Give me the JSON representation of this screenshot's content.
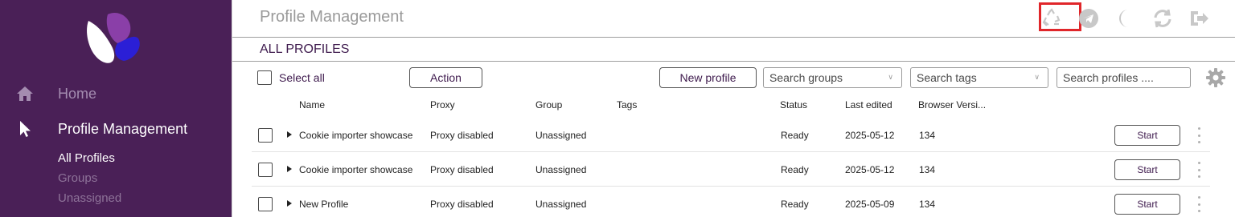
{
  "sidebar": {
    "items": [
      {
        "label": "Home",
        "icon": "home-icon"
      },
      {
        "label": "Profile Management",
        "icon": "cursor-icon"
      }
    ],
    "sub_items": [
      "All Profiles",
      "Groups",
      "Unassigned"
    ]
  },
  "header": {
    "title": "Profile Management",
    "icons": [
      "recycle-icon",
      "telegram-icon",
      "moon-icon",
      "sync-icon",
      "logout-icon"
    ]
  },
  "section": {
    "title": "ALL PROFILES"
  },
  "toolbar": {
    "select_all": "Select all",
    "action": "Action",
    "new_profile": "New profile",
    "search_groups": "Search groups",
    "search_tags": "Search tags",
    "search_profiles": "Search profiles ...."
  },
  "table": {
    "columns": [
      "Name",
      "Proxy",
      "Group",
      "Tags",
      "Status",
      "Last edited",
      "Browser Versi..."
    ],
    "rows": [
      {
        "name": "Cookie importer showcase",
        "proxy": "Proxy disabled",
        "group": "Unassigned",
        "tags": "",
        "status": "Ready",
        "last_edited": "2025-05-12",
        "browser_version": "134",
        "action": "Start"
      },
      {
        "name": "Cookie importer showcase",
        "proxy": "Proxy disabled",
        "group": "Unassigned",
        "tags": "",
        "status": "Ready",
        "last_edited": "2025-05-12",
        "browser_version": "134",
        "action": "Start"
      },
      {
        "name": "New Profile",
        "proxy": "Proxy disabled",
        "group": "Unassigned",
        "tags": "",
        "status": "Ready",
        "last_edited": "2025-05-09",
        "browser_version": "134",
        "action": "Start"
      }
    ]
  },
  "colors": {
    "sidebar_bg": "#4a2057",
    "accent_purple": "#3e1a4d",
    "highlight_red": "#e0262a",
    "logo_purple": "#8a3fa8",
    "logo_blue": "#2b1fd6"
  }
}
